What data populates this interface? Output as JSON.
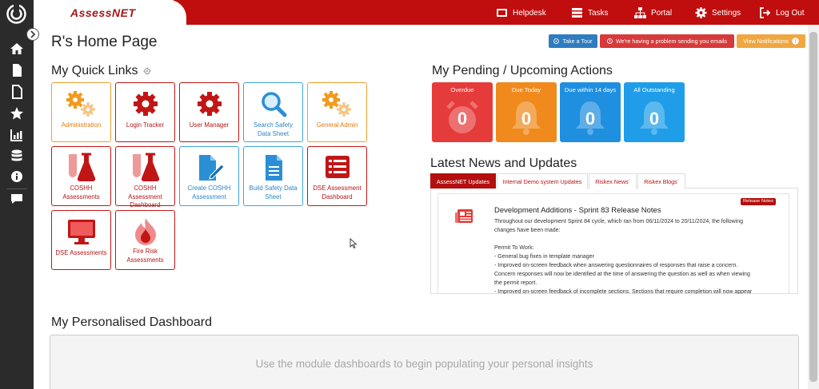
{
  "app": {
    "logo": "AssessNET"
  },
  "topnav": [
    {
      "label": "Helpdesk",
      "icon": "helpdesk-icon"
    },
    {
      "label": "Tasks",
      "icon": "tasks-icon"
    },
    {
      "label": "Portal",
      "icon": "portal-icon"
    },
    {
      "label": "Settings",
      "icon": "gear-icon"
    },
    {
      "label": "Log Out",
      "icon": "logout-icon"
    }
  ],
  "page": {
    "title": "R's Home Page"
  },
  "actions": {
    "tour": "Take a Tour",
    "email_problem": "We're having a problem sending you emails",
    "notifications": "View Notifications"
  },
  "quick_links": {
    "title": "My Quick Links",
    "items": [
      {
        "label": "Administration",
        "icon": "gears-icon",
        "color": "orange"
      },
      {
        "label": "Login Tracker",
        "icon": "gear-icon",
        "color": "red"
      },
      {
        "label": "User Manager",
        "icon": "gear-icon",
        "color": "red"
      },
      {
        "label": "Search Safety Data Sheet",
        "icon": "search-icon",
        "color": "blue"
      },
      {
        "label": "General Admin",
        "icon": "gears-icon",
        "color": "orange"
      },
      {
        "label": "COSHH Assessments",
        "icon": "flask-icon",
        "color": "red"
      },
      {
        "label": "COSHH Assessment Dashboard",
        "icon": "flask-icon",
        "color": "red"
      },
      {
        "label": "Create COSHH Assessment",
        "icon": "edit-document-icon",
        "color": "blue"
      },
      {
        "label": "Build Safety Data Sheet",
        "icon": "document-icon",
        "color": "blue"
      },
      {
        "label": "DSE Assessment Dashboard",
        "icon": "list-icon",
        "color": "red"
      },
      {
        "label": "DSE Assessments",
        "icon": "monitor-icon",
        "color": "red"
      },
      {
        "label": "Fire Risk Assessments",
        "icon": "fire-icon",
        "color": "red"
      }
    ]
  },
  "pending": {
    "title": "My Pending / Upcoming Actions",
    "tiles": [
      {
        "label": "Overdue",
        "value": "0",
        "color": "#e63b3b"
      },
      {
        "label": "Due Today",
        "value": "0",
        "color": "#f08a1c"
      },
      {
        "label": "Due within 14 days",
        "value": "0",
        "color": "#1f8fe0"
      },
      {
        "label": "All Outstanding",
        "value": "0",
        "color": "#1f9de8"
      }
    ]
  },
  "news": {
    "title": "Latest News and Updates",
    "tabs": [
      "AssessNET Updates",
      "Internal Demo system Updates",
      "Riskex News",
      "Riskex Blogs"
    ],
    "badge": "Release Notes",
    "item_title": "Development Additions - Sprint 83 Release Notes",
    "body_lines": [
      "Throughout our development Sprint 84 cycle, which ran from 06/11/2024 to 20/11/2024, the following",
      "changes have been made:",
      "",
      "Permit To Work:",
      "- General bug fixes in template manager",
      "- Improved on-screen feedback when answering questionnaires of responses that raise a concern.",
      "Concern responses will now be identified at the time of answering the question as well as when viewing",
      "the permit report.",
      "- Improved on-screen feedback of incomplete sections. Sections that require completion will now appear"
    ]
  },
  "dashboard": {
    "title": "My Personalised Dashboard",
    "message": "Use the module dashboards to begin populating your personal insights"
  }
}
